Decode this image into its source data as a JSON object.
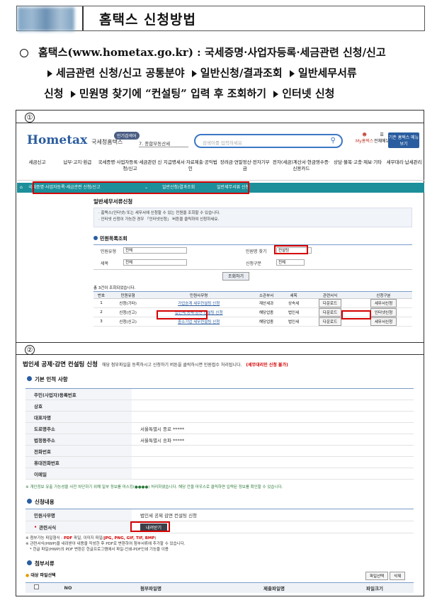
{
  "header": {
    "title": "홈택스 신청방법"
  },
  "intro": {
    "line1_a": "홈택스(www.hometax.go.kr) : 국세증명·사업자등록·세금관련 신청/신고",
    "line2": [
      "세금관련 신청/신고 공통분야",
      "일반신청/결과조회",
      "일반세무서류"
    ],
    "line3": [
      "신청",
      "민원명 찾기에 “컨설팅” 입력 후 조회하기",
      "인터넷 신청"
    ]
  },
  "step1": {
    "num": "①",
    "logo": "Hometax",
    "logo_sub": "국세청홈택스",
    "pill": "인기검색어",
    "select": "7. 종합부동산세",
    "search_placeholder": "검색어를 입력하세요",
    "my": "My홈택스",
    "menu": "전체메뉴",
    "old_btn": "기존 홈택스 메뉴 보기",
    "gnb": [
      "세금신고",
      "납부·고지·환급",
      "국세증명·사업자등록·세금관련 신청/신고",
      "지급명세서·자료제출·공익법인",
      "장려금·연말정산·전자기부금",
      "전자(세금)계산서·현금영수증·신용카드",
      "상담·불복·고충·제보·기타",
      "세무대리·납세관리"
    ],
    "crumb": [
      "국세증명·사업자등록·세금관련 신청/신고",
      "일반신청/결과조회",
      "일반세무서류 신청"
    ],
    "page_title": "일반세무서류신청",
    "info1": "· 홈택스(인터넷) 또는 세무서에 신청할 수 있는 민원을 조회할 수 있습니다.",
    "info2": "· 인터넷 신청이 가능한 경우 「인터넷신청」 버튼을 클릭하여 신청하세요.",
    "sect": "민원목록조회",
    "f_type": "민원유형",
    "f_type_v": "전체",
    "f_find": "민원명 찾기",
    "f_find_v": "컨설팅",
    "f_tax": "세목",
    "f_tax_v": "전체",
    "f_apply": "신청구분",
    "f_apply_v": "전체",
    "inquiry": "조회하기",
    "count": "총 3건이 조회되었습니다.",
    "cols": [
      "번호",
      "민원유형",
      "민원사무명",
      "소관부서",
      "세목",
      "관련서식",
      "신청구분"
    ],
    "rows": [
      {
        "no": "1",
        "type": "신청(기타)",
        "name": "가업승계 세무컨설팅 신청",
        "dept": "재산세과",
        "tax": "상속세",
        "form": "다운로드",
        "apply": "세무서신청"
      },
      {
        "no": "2",
        "type": "신청(신고)",
        "name": "법인세 공제·감면 컨설팅 신청",
        "dept": "해당업종",
        "tax": "법인세",
        "form": "다운로드",
        "apply": "인터넷신청"
      },
      {
        "no": "3",
        "type": "신청(신고)",
        "name": "중소기업 세무컨설팅 신청",
        "dept": "해당업종",
        "tax": "법인세",
        "form": "다운로드",
        "apply": "세무서신청"
      }
    ]
  },
  "step2": {
    "num": "②",
    "title": "법인세 공제·감면 컨설팅 신청",
    "sub": "해당 첨부파일을 등록하시고 신청하기 버튼을 클릭하시면 민원접수 처리됩니다.",
    "warn": "(세무대리인 신청 불가)",
    "sec1": "기본 인적 사항",
    "fields": [
      {
        "k": "주민(사업자)등록번호",
        "v": ""
      },
      {
        "k": "상호",
        "v": ""
      },
      {
        "k": "대표자명",
        "v": ""
      },
      {
        "k": "도로명주소",
        "v": "서울특별시 종로 *****"
      },
      {
        "k": "법정동주소",
        "v": "서울특별시 송파 *****"
      },
      {
        "k": "전화번호",
        "v": ""
      },
      {
        "k": "휴대전화번호",
        "v": ""
      },
      {
        "k": "이메일",
        "v": ""
      }
    ],
    "note": "※ 개인정보 유출 가능성을 사전 차단하기 위해 일부 정보를 마스킹(●●●●) 처리하였습니다. 해당 칸을 마우스로 클릭하면 입력된 정보를 확인할 수 있습니다.",
    "sec2": "신청내용",
    "c_name": "민원사무명",
    "c_name_v": "법인세 공제 감면 컨설팅 신청",
    "c_form": "관련서식",
    "dl": "내려받기",
    "n1a": "※ 첨부가능 파일형식 : ",
    "n1b": "PDF",
    "n1c": " 파일, 이미지 파일(",
    "n1d": "JPG, PNG, GIF, TIF, BMP",
    "n1e": ")",
    "n2": "※ 관련서식(HWP)을 내려받아 내용을 작성한 후 PDF로 변환하여 첨부서류에 추가할 수 있습니다.",
    "n3": "* 한글 파일(HWP)의 PDF 변환은 한글프로그램에서 파일-인쇄-PDF인쇄 기능을 이용",
    "sec3": "첨부서류",
    "sec3b": "대상 파일선택",
    "pick": "파일선택",
    "del": "삭제",
    "tcols": [
      "NO",
      "첨부파일명",
      "제출파일명",
      "파일크기"
    ]
  }
}
